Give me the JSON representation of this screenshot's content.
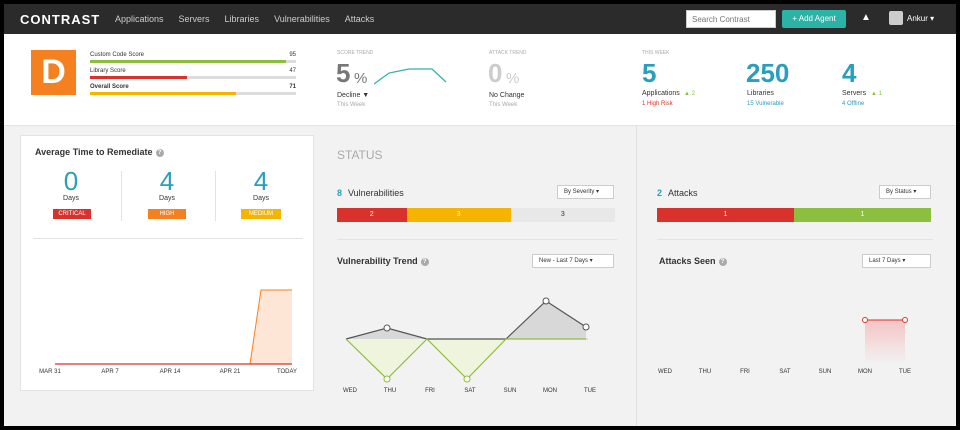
{
  "nav": {
    "logo": "CONTRAST",
    "links": [
      "Applications",
      "Servers",
      "Libraries",
      "Vulnerabilities",
      "Attacks"
    ],
    "search_placeholder": "Search Contrast",
    "add_agent": "+ Add Agent",
    "user": "Ankur ▾"
  },
  "grade": {
    "letter": "D",
    "scores": [
      {
        "label": "Custom Code Score",
        "value": "95",
        "fill": 0.95,
        "color": "#8cbf3f"
      },
      {
        "label": "Library Score",
        "value": "47",
        "fill": 0.47,
        "color": "#d9312b"
      },
      {
        "label": "Overall Score",
        "value": "71",
        "fill": 0.71,
        "color": "#f5b400"
      }
    ]
  },
  "score_trend": {
    "label": "SCORE TREND",
    "value": "5",
    "unit": "%",
    "status": "Decline ▼",
    "period": "This Week"
  },
  "attack_trend": {
    "label": "ATTACK TREND",
    "value": "0",
    "unit": "%",
    "status": "No Change",
    "period": "This Week"
  },
  "this_week": {
    "label": "THIS WEEK",
    "applications": {
      "value": "5",
      "label": "Applications",
      "delta": "▲ 2",
      "note": "1 High Risk"
    },
    "libraries": {
      "value": "250",
      "label": "Libraries",
      "note": "15 Vulnerable"
    },
    "servers": {
      "value": "4",
      "label": "Servers",
      "delta": "▲ 1",
      "note": "4 Offline"
    }
  },
  "remediate": {
    "title": "Average Time to Remediate",
    "stats": [
      {
        "value": "0",
        "unit": "Days",
        "severity": "CRITICAL",
        "color": "#d9312b"
      },
      {
        "value": "4",
        "unit": "Days",
        "severity": "HIGH",
        "color": "#f58020"
      },
      {
        "value": "4",
        "unit": "Days",
        "severity": "MEDIUM",
        "color": "#f5b400"
      }
    ],
    "x_labels": [
      "MAR 31",
      "APR 7",
      "APR 14",
      "APR 21",
      "TODAY"
    ]
  },
  "status": {
    "heading": "STATUS",
    "vulns": {
      "count": "8",
      "label": "Vulnerabilities",
      "dropdown": "By Severity ▾",
      "segments": [
        {
          "value": "2",
          "color": "#d9312b",
          "weight": 2
        },
        {
          "value": "3",
          "color": "#f5b400",
          "weight": 3
        },
        {
          "value": "3",
          "color": "#e8e8e8",
          "weight": 3
        }
      ]
    },
    "attacks": {
      "count": "2",
      "label": "Attacks",
      "dropdown": "By Status ▾",
      "segments": [
        {
          "value": "1",
          "color": "#d9312b",
          "weight": 1
        },
        {
          "value": "1",
          "color": "#8cbf3f",
          "weight": 1
        }
      ]
    }
  },
  "vuln_trend": {
    "title": "Vulnerability Trend",
    "dropdown": "New - Last 7 Days ▾",
    "days": [
      "WED",
      "THU",
      "FRI",
      "SAT",
      "SUN",
      "MON",
      "TUE"
    ]
  },
  "attacks_seen": {
    "title": "Attacks Seen",
    "dropdown": "Last 7 Days ▾",
    "days": [
      "WED",
      "THU",
      "FRI",
      "SAT",
      "SUN",
      "MON",
      "TUE"
    ]
  }
}
